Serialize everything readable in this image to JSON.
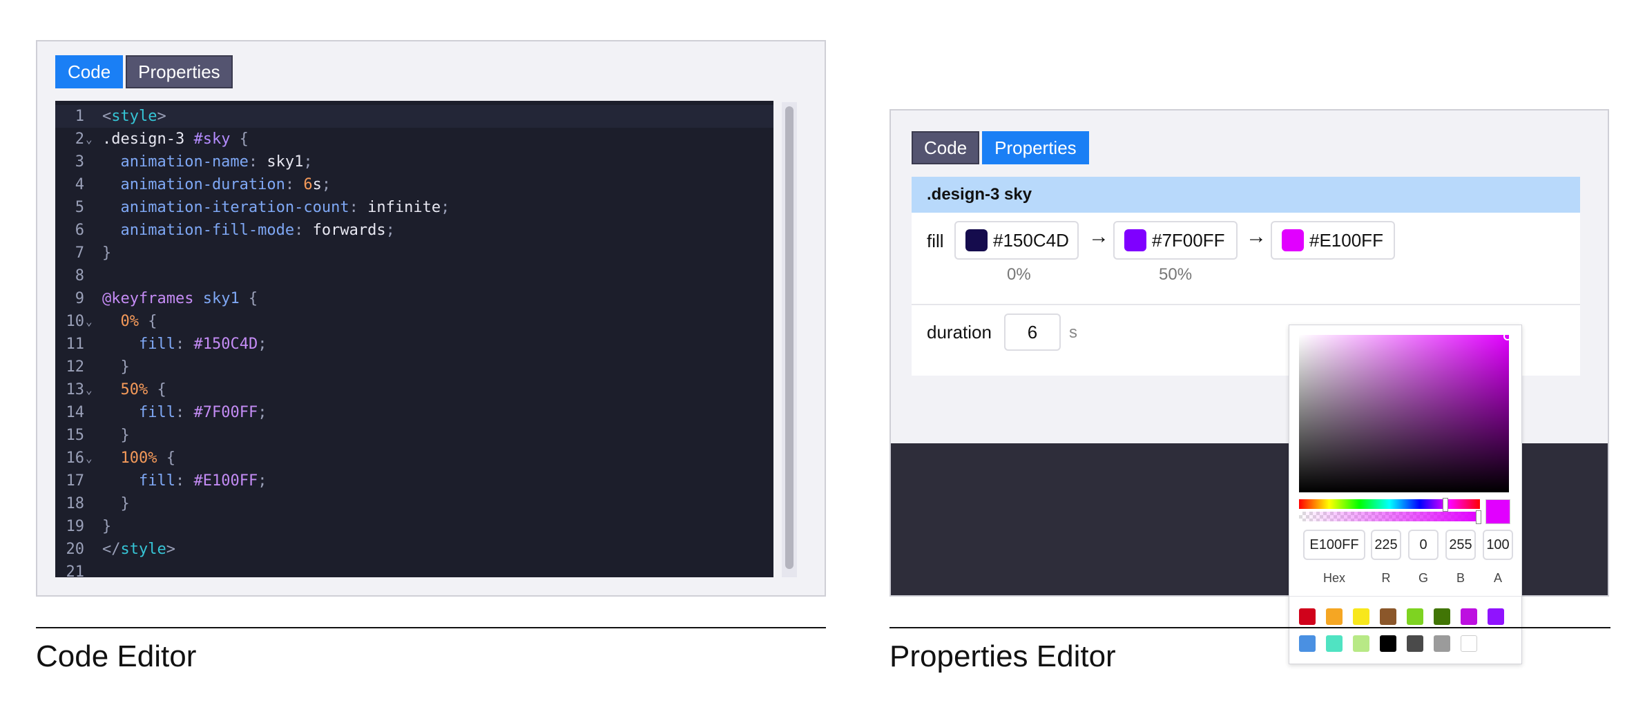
{
  "code_editor": {
    "tabs": [
      {
        "label": "Code",
        "active": true
      },
      {
        "label": "Properties",
        "active": false
      }
    ],
    "lines": [
      {
        "n": "1",
        "fold": false,
        "tokens": [
          {
            "t": "<",
            "c": "punct"
          },
          {
            "t": "style",
            "c": "tag"
          },
          {
            "t": ">",
            "c": "punct"
          }
        ]
      },
      {
        "n": "2",
        "fold": true,
        "tokens": [
          {
            "t": ".design-3 ",
            "c": "sel"
          },
          {
            "t": "#sky",
            "c": "id"
          },
          {
            "t": " {",
            "c": "punct"
          }
        ]
      },
      {
        "n": "3",
        "fold": false,
        "tokens": [
          {
            "t": "  animation-name",
            "c": "prop"
          },
          {
            "t": ": ",
            "c": "punct"
          },
          {
            "t": "sky1",
            "c": "val"
          },
          {
            "t": ";",
            "c": "punct"
          }
        ]
      },
      {
        "n": "4",
        "fold": false,
        "tokens": [
          {
            "t": "  animation-duration",
            "c": "prop"
          },
          {
            "t": ": ",
            "c": "punct"
          },
          {
            "t": "6",
            "c": "num"
          },
          {
            "t": "s",
            "c": "val"
          },
          {
            "t": ";",
            "c": "punct"
          }
        ]
      },
      {
        "n": "5",
        "fold": false,
        "tokens": [
          {
            "t": "  animation-iteration-count",
            "c": "prop"
          },
          {
            "t": ": ",
            "c": "punct"
          },
          {
            "t": "infinite",
            "c": "val"
          },
          {
            "t": ";",
            "c": "punct"
          }
        ]
      },
      {
        "n": "6",
        "fold": false,
        "tokens": [
          {
            "t": "  animation-fill-mode",
            "c": "prop"
          },
          {
            "t": ": ",
            "c": "punct"
          },
          {
            "t": "forwards",
            "c": "val"
          },
          {
            "t": ";",
            "c": "punct"
          }
        ]
      },
      {
        "n": "7",
        "fold": false,
        "tokens": [
          {
            "t": "}",
            "c": "punct"
          }
        ]
      },
      {
        "n": "8",
        "fold": false,
        "tokens": []
      },
      {
        "n": "9",
        "fold": false,
        "tokens": [
          {
            "t": "@keyframes",
            "c": "at"
          },
          {
            "t": " ",
            "c": "punct"
          },
          {
            "t": "sky1",
            "c": "kfname"
          },
          {
            "t": " {",
            "c": "punct"
          }
        ]
      },
      {
        "n": "10",
        "fold": true,
        "tokens": [
          {
            "t": "  0",
            "c": "num"
          },
          {
            "t": "%",
            "c": "num"
          },
          {
            "t": " {",
            "c": "punct"
          }
        ]
      },
      {
        "n": "11",
        "fold": false,
        "tokens": [
          {
            "t": "    fill",
            "c": "prop"
          },
          {
            "t": ": ",
            "c": "punct"
          },
          {
            "t": "#150C4D",
            "c": "hex"
          },
          {
            "t": ";",
            "c": "punct"
          }
        ]
      },
      {
        "n": "12",
        "fold": false,
        "tokens": [
          {
            "t": "  }",
            "c": "punct"
          }
        ]
      },
      {
        "n": "13",
        "fold": true,
        "tokens": [
          {
            "t": "  50",
            "c": "num"
          },
          {
            "t": "%",
            "c": "num"
          },
          {
            "t": " {",
            "c": "punct"
          }
        ]
      },
      {
        "n": "14",
        "fold": false,
        "tokens": [
          {
            "t": "    fill",
            "c": "prop"
          },
          {
            "t": ": ",
            "c": "punct"
          },
          {
            "t": "#7F00FF",
            "c": "hex"
          },
          {
            "t": ";",
            "c": "punct"
          }
        ]
      },
      {
        "n": "15",
        "fold": false,
        "tokens": [
          {
            "t": "  }",
            "c": "punct"
          }
        ]
      },
      {
        "n": "16",
        "fold": true,
        "tokens": [
          {
            "t": "  100",
            "c": "num"
          },
          {
            "t": "%",
            "c": "num"
          },
          {
            "t": " {",
            "c": "punct"
          }
        ]
      },
      {
        "n": "17",
        "fold": false,
        "tokens": [
          {
            "t": "    fill",
            "c": "prop"
          },
          {
            "t": ": ",
            "c": "punct"
          },
          {
            "t": "#E100FF",
            "c": "hex"
          },
          {
            "t": ";",
            "c": "punct"
          }
        ]
      },
      {
        "n": "18",
        "fold": false,
        "tokens": [
          {
            "t": "  }",
            "c": "punct"
          }
        ]
      },
      {
        "n": "19",
        "fold": false,
        "tokens": [
          {
            "t": "}",
            "c": "punct"
          }
        ]
      },
      {
        "n": "20",
        "fold": false,
        "tokens": [
          {
            "t": "</",
            "c": "punct"
          },
          {
            "t": "style",
            "c": "tag"
          },
          {
            "t": ">",
            "c": "punct"
          }
        ]
      },
      {
        "n": "21",
        "fold": false,
        "tokens": []
      }
    ],
    "caption": "Code Editor"
  },
  "properties_editor": {
    "tabs": [
      {
        "label": "Code",
        "active": false
      },
      {
        "label": "Properties",
        "active": true
      }
    ],
    "selector": ".design-3 sky",
    "fill_label": "fill",
    "stops": [
      {
        "hex": "#150C4D",
        "color": "#150C4D",
        "pct": "0%"
      },
      {
        "hex": "#7F00FF",
        "color": "#7F00FF",
        "pct": "50%"
      },
      {
        "hex": "#E100FF",
        "color": "#E100FF",
        "pct": ""
      }
    ],
    "arrow": "→",
    "duration_label": "duration",
    "duration_value": "6",
    "duration_unit": "s",
    "picker": {
      "hex": "E100FF",
      "r": "225",
      "g": "0",
      "b": "255",
      "a": "100",
      "labels": {
        "hex": "Hex",
        "r": "R",
        "g": "G",
        "b": "B",
        "a": "A"
      },
      "presets": [
        "#D0021B",
        "#F5A623",
        "#F8E71C",
        "#8B572A",
        "#7ED321",
        "#417505",
        "#BD10E0",
        "#9013FE",
        "#4A90E2",
        "#50E3C2",
        "#B8E986",
        "#000000",
        "#4A4A4A",
        "#9B9B9B",
        "#FFFFFF"
      ]
    },
    "caption": "Properties Editor"
  }
}
